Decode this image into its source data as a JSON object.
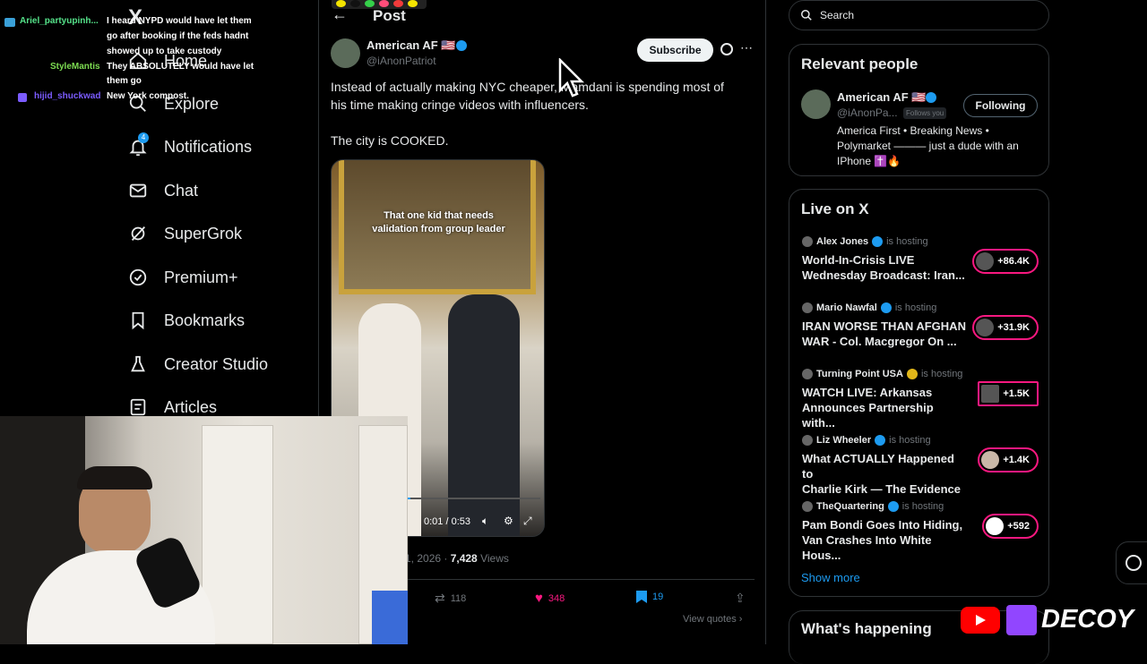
{
  "window": {
    "width": 1280,
    "height": 720
  },
  "chat_overlay": {
    "lines": [
      {
        "user": "Ariel_partyupinh...",
        "user_color": "#55e38a",
        "message_1": "I heard NYPD would have let them",
        "message_2": "go after booking if the feds hadnt",
        "message_3": "showed up to take custody"
      },
      {
        "user": "StyleMantis",
        "user_color": "#7ddc52",
        "message_1": "They ABSOLUTELY would have let",
        "message_2": "them go"
      },
      {
        "user": "hijid_shuckwad",
        "user_color": "#7b5cff",
        "message_1": "New York compost."
      }
    ]
  },
  "sidebar": {
    "logo": "X",
    "items": [
      {
        "label": "Home",
        "icon": "home-icon"
      },
      {
        "label": "Explore",
        "icon": "search-icon"
      },
      {
        "label": "Notifications",
        "icon": "bell-icon",
        "badge": "4"
      },
      {
        "label": "Chat",
        "icon": "mail-icon"
      },
      {
        "label": "SuperGrok",
        "icon": "grok-icon"
      },
      {
        "label": "Premium+",
        "icon": "verified-badge-icon"
      },
      {
        "label": "Bookmarks",
        "icon": "bookmark-icon"
      },
      {
        "label": "Creator Studio",
        "icon": "flask-icon"
      },
      {
        "label": "Articles",
        "icon": "article-icon"
      }
    ]
  },
  "post": {
    "header_title": "Post",
    "author_name": "American AF 🇺🇸",
    "author_handle": "@iAnonPatriot",
    "subscribe_label": "Subscribe",
    "text_line_1": "Instead of actually making NYC cheaper, Mamdani is spending most of",
    "text_line_2": "his time making cringe videos with influencers.",
    "text_line_3": "The city is COOKED.",
    "video_caption_1": "That one kid that needs",
    "video_caption_2": "validation from group leader",
    "video_time": "0:01 / 0:53",
    "video_progress": 0.02,
    "date_partial": "1, 2026 · ",
    "views_count": "7,428",
    "views_label": " Views",
    "reposts": "118",
    "likes": "348",
    "bookmarks": "19",
    "view_quotes": "View quotes"
  },
  "search": {
    "placeholder": "Search"
  },
  "relevant_people": {
    "title": "Relevant people",
    "name": "American AF 🇺🇸",
    "handle": "@iAnonPa...",
    "follows_you": "Follows you",
    "following_label": "Following",
    "bio_1": "America First • Breaking News •",
    "bio_2": "Polymarket ——— just a dude with an",
    "bio_3": "IPhone ✝️🔥"
  },
  "live": {
    "title": "Live on X",
    "show_more": "Show more",
    "items": [
      {
        "host": "Alex Jones",
        "status": "is hosting",
        "title_1": "World-In-Crisis LIVE",
        "title_2": "Wednesday Broadcast: Iran...",
        "count": "+86.4K"
      },
      {
        "host": "Mario Nawfal",
        "status": "is hosting",
        "title_1": "IRAN WORSE THAN AFGHAN",
        "title_2": "WAR - Col. Macgregor On ...",
        "count": "+31.9K"
      },
      {
        "host": "Turning Point USA",
        "status": "is hosting",
        "title_1": "WATCH LIVE: Arkansas",
        "title_2": "Announces Partnership with...",
        "count": "+1.5K"
      },
      {
        "host": "Liz Wheeler",
        "status": "is hosting",
        "title_1": "What ACTUALLY Happened to",
        "title_2": "Charlie Kirk — The Evidence ...",
        "count": "+1.4K"
      },
      {
        "host": "TheQuartering",
        "status": "is hosting",
        "title_1": "Pam Bondi Goes Into Hiding,",
        "title_2": "Van Crashes Into White Hous...",
        "count": "+592"
      }
    ]
  },
  "whats_happening": {
    "title": "What's happening"
  },
  "stream_branding": {
    "text": "DECOY"
  },
  "colors": {
    "accent": "#1d9bf0",
    "like": "#f91880",
    "border": "#2f3336",
    "muted": "#71767b"
  }
}
